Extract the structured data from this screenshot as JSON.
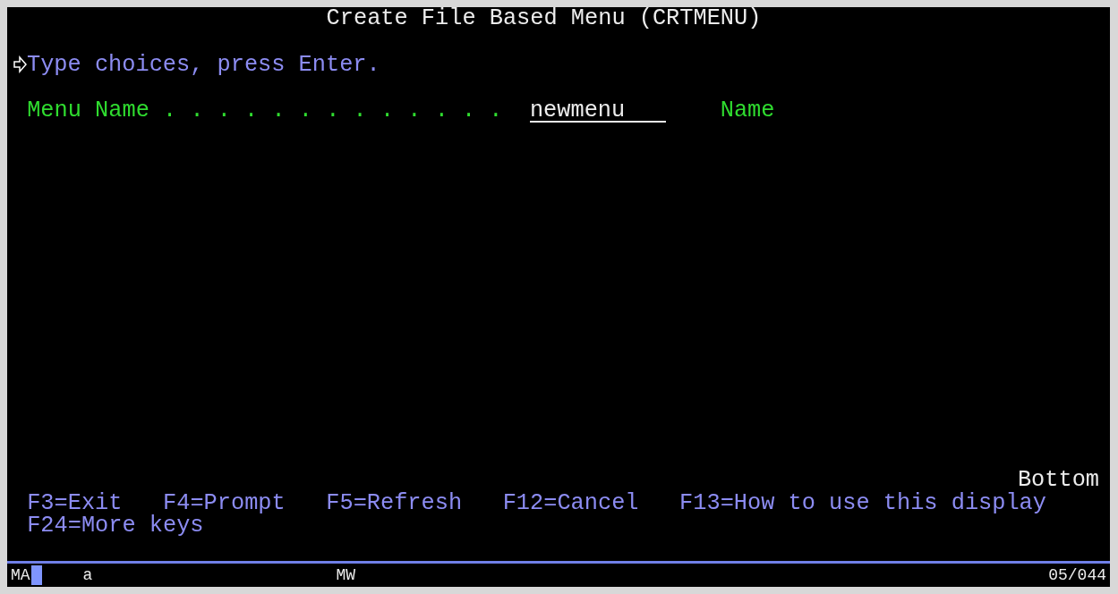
{
  "screen": {
    "title": "Create File Based Menu (CRTMENU)",
    "instruction": "Type choices, press Enter.",
    "fields": [
      {
        "label": "Menu Name",
        "leader": ". . . . . . . . . . . . .",
        "value": "newmenu",
        "hint": "Name"
      }
    ],
    "position": "Bottom",
    "function_keys": [
      [
        "F3=Exit",
        "F4=Prompt",
        "F5=Refresh",
        "F12=Cancel",
        "F13=How to use this display"
      ],
      [
        "F24=More keys"
      ]
    ]
  },
  "status_bar": {
    "mode": "MA",
    "input": "a",
    "indicator": "MW",
    "cursor_position": "05/044"
  }
}
